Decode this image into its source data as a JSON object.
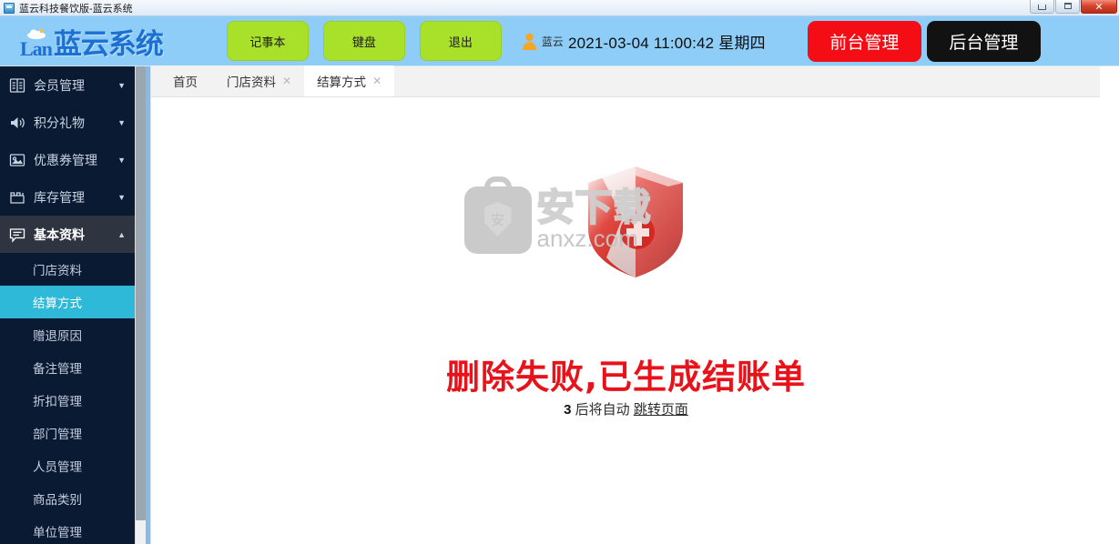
{
  "window": {
    "title": "蓝云科技餐饮版-蓝云系统",
    "icon": "app-icon",
    "controls": {
      "minimize": "minimize-icon",
      "maximize": "maximize-icon",
      "close": "✕"
    }
  },
  "header": {
    "logo_mark": "Lan",
    "logo_text": "蓝云系统",
    "buttons": [
      {
        "label": "记事本",
        "name": "notepad-button"
      },
      {
        "label": "键盘",
        "name": "keyboard-button"
      },
      {
        "label": "退出",
        "name": "logout-button"
      }
    ],
    "user": {
      "icon": "user-icon",
      "name": "蓝云",
      "datetime": "2021-03-04  11:00:42  星期四"
    },
    "mode_buttons": [
      {
        "label": "前台管理",
        "name": "front-desk-button",
        "color": "#f40d15"
      },
      {
        "label": "后台管理",
        "name": "back-office-button",
        "color": "#121212"
      }
    ]
  },
  "sidebar": {
    "groups": [
      {
        "label": "会员管理",
        "icon": "address-book-icon",
        "expanded": false,
        "arrow": "▼"
      },
      {
        "label": "积分礼物",
        "icon": "speaker-icon",
        "expanded": false,
        "arrow": "▼"
      },
      {
        "label": "优惠券管理",
        "icon": "coupon-image-icon",
        "expanded": false,
        "arrow": "▼"
      },
      {
        "label": "库存管理",
        "icon": "inventory-icon",
        "expanded": false,
        "arrow": "▼"
      },
      {
        "label": "基本资料",
        "icon": "speech-bubble-icon",
        "expanded": true,
        "arrow": "▲"
      }
    ],
    "sub_items": [
      {
        "label": "门店资料",
        "active": false
      },
      {
        "label": "结算方式",
        "active": true
      },
      {
        "label": "赠退原因",
        "active": false
      },
      {
        "label": "备注管理",
        "active": false
      },
      {
        "label": "折扣管理",
        "active": false
      },
      {
        "label": "部门管理",
        "active": false
      },
      {
        "label": "人员管理",
        "active": false
      },
      {
        "label": "商品类别",
        "active": false
      },
      {
        "label": "单位管理",
        "active": false
      }
    ],
    "active_color": "#2fb9d9"
  },
  "tabs": [
    {
      "label": "首页",
      "closable": false,
      "active": false
    },
    {
      "label": "门店资料",
      "closable": true,
      "active": false,
      "close": "✕"
    },
    {
      "label": "结算方式",
      "closable": true,
      "active": true,
      "close": "✕"
    }
  ],
  "main": {
    "watermark": {
      "cn": "安下载",
      "url": "anxz.com",
      "badge": "安"
    },
    "error_message": "删除失败,已生成结账单",
    "error_color": "#e8131a",
    "countdown": {
      "seconds": "3",
      "text": "后将自动",
      "link": "跳转页面"
    }
  }
}
